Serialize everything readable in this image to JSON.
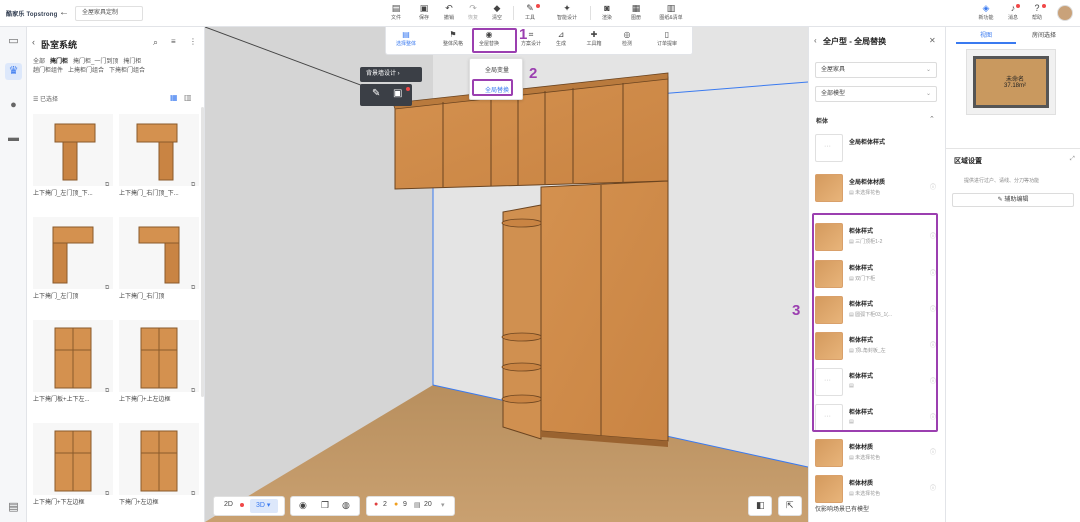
{
  "topbar": {
    "logo": "酷家乐 Topstrong",
    "design_name": "全屋家具定制",
    "tools": [
      {
        "label": "文件",
        "icon": "file-icon"
      },
      {
        "label": "保存",
        "icon": "save-icon"
      },
      {
        "label": "撤销",
        "icon": "undo-icon"
      },
      {
        "label": "恢复",
        "icon": "redo-icon"
      },
      {
        "label": "清空",
        "icon": "eraser-icon"
      },
      {
        "label": "工具",
        "icon": "wrench-icon"
      },
      {
        "label": "智能设计",
        "icon": "magic-icon"
      },
      {
        "label": "渲染",
        "icon": "camera-icon"
      },
      {
        "label": "图册",
        "icon": "album-icon"
      },
      {
        "label": "图纸&清单",
        "icon": "drawing-icon"
      }
    ],
    "right_tools": [
      {
        "label": "新功能",
        "icon": "new-icon"
      },
      {
        "label": "消息",
        "icon": "bell-icon"
      },
      {
        "label": "帮助",
        "icon": "help-icon"
      }
    ]
  },
  "rail": [
    "home-icon",
    "cabinet-icon",
    "user-icon",
    "sofa-icon",
    "module-icon"
  ],
  "lpanel": {
    "title": "卧室系统",
    "tabs": [
      "全部",
      "掩门柜",
      "掩门柜_一门到顶",
      "掩门柜"
    ],
    "tabs_row2": [
      "趟门柜组件",
      "上掩柜门组合",
      "下掩柜门组合"
    ],
    "filter": "已选择",
    "items": [
      "上下掩门_左门顶_下...",
      "上下掩门_右门顶_下...",
      "上下掩门_左门顶",
      "上下掩门_右门顶",
      "上下掩门板+上下左...",
      "上下掩门+上左边框",
      "上下掩门+下左边框",
      "下掩门+左边框"
    ]
  },
  "subbar": {
    "items": [
      "选择整体",
      "整体风格",
      "全屋替换",
      "方案设计",
      "生成",
      "工具箱",
      "检测",
      "订单提审"
    ],
    "active_index": 0,
    "highlight_index": 2
  },
  "dropdown": {
    "items": [
      "全局变量",
      "全局替换"
    ],
    "selected": 1
  },
  "floatbar": {
    "label": "背景墙设计"
  },
  "annotations": [
    "1",
    "2",
    "3"
  ],
  "bottombar": {
    "view2d": "2D",
    "view3d": "3D",
    "err_count": "2",
    "warn_count": "9",
    "info_count": "20"
  },
  "rpanel": {
    "title": "全户型 - 全局替换",
    "select1": "全屋家具",
    "select2": "全部模型",
    "section": "柜体",
    "rows": [
      {
        "title": "全局柜体样式",
        "sub": "",
        "wood": false
      },
      {
        "title": "全局柜体材质",
        "sub": "未选择花色",
        "wood": true
      },
      {
        "title": "柜体样式",
        "sub": "三门顶柜1-2",
        "wood": true
      },
      {
        "title": "柜体样式",
        "sub": "双门下柜",
        "wood": true
      },
      {
        "title": "柜体样式",
        "sub": "圆弧下柜03_1(...",
        "wood": true
      },
      {
        "title": "柜体样式",
        "sub": "顶L角封板_左",
        "wood": true
      },
      {
        "title": "柜体样式",
        "sub": "",
        "wood": false
      },
      {
        "title": "柜体样式",
        "sub": "",
        "wood": false
      },
      {
        "title": "柜体材质",
        "sub": "未选择花色",
        "wood": true
      },
      {
        "title": "柜体材质",
        "sub": "未选择花色",
        "wood": true
      }
    ],
    "footer": "仅影响场景已有模型"
  },
  "frpanel": {
    "tabs": [
      "视图",
      "房间选择"
    ],
    "room_name": "未命名",
    "room_area": "37.18m²",
    "section": "区域设置",
    "note": "提供进行过户、请线、分刀等功能",
    "button": "辅助编辑"
  },
  "colors": {
    "accent": "#3a7af0",
    "highlight": "#9b3fb0",
    "wood": "#d4995a"
  }
}
